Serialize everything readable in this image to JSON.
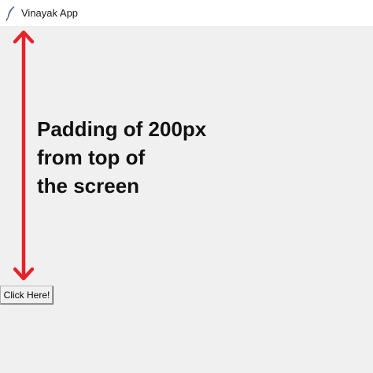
{
  "window": {
    "title": "Vinayak App",
    "icon": "feather-icon"
  },
  "annotation": {
    "lines": [
      "Padding of 200px",
      "from top of",
      "the screen"
    ],
    "arrow_color": "#e8202a"
  },
  "button": {
    "label": "Click Here!"
  }
}
